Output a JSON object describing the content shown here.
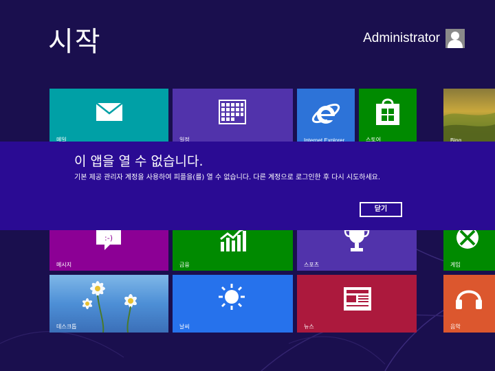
{
  "screen": {
    "title": "시작",
    "user": {
      "name": "Administrator",
      "icon": "user-avatar-icon"
    }
  },
  "tiles": {
    "mail": {
      "label": "메일",
      "color": "#00a0a6",
      "icon": "mail-icon"
    },
    "calendar": {
      "label": "일정",
      "color": "#5133ab",
      "icon": "calendar-icon"
    },
    "ie": {
      "label": "Internet Explorer",
      "color": "#2d73d8",
      "icon": "internet-explorer-icon"
    },
    "store": {
      "label": "스토어",
      "color": "#008a00",
      "icon": "store-icon"
    },
    "bing": {
      "label": "Bing",
      "icon": "bing-photo-icon"
    },
    "messaging": {
      "label": "메시지",
      "color": "#8c0095",
      "icon": "messaging-icon"
    },
    "finance": {
      "label": "금융",
      "color": "#008a00",
      "icon": "finance-chart-icon"
    },
    "sports": {
      "label": "스포츠",
      "color": "#5133ab",
      "icon": "sports-trophy-icon"
    },
    "games": {
      "label": "게임",
      "color": "#008a00",
      "icon": "game-controller-icon"
    },
    "desktop": {
      "label": "데스크톱",
      "icon": "desktop-daisy-icon"
    },
    "weather": {
      "label": "날씨",
      "color": "#2672ec",
      "icon": "weather-sun-icon"
    },
    "news": {
      "label": "뉴스",
      "color": "#ac193d",
      "icon": "news-icon"
    },
    "music": {
      "label": "음악",
      "color": "#dc572e",
      "icon": "headphones-icon"
    }
  },
  "dialog": {
    "title": "이 앱을 열 수 없습니다.",
    "message": "기본 제공 관리자 계정을 사용하여 피플을(를) 열 수 없습니다. 다른 계정으로 로그인한 후 다시 시도하세요.",
    "close_label": "닫기",
    "background": "#2a0b93"
  }
}
